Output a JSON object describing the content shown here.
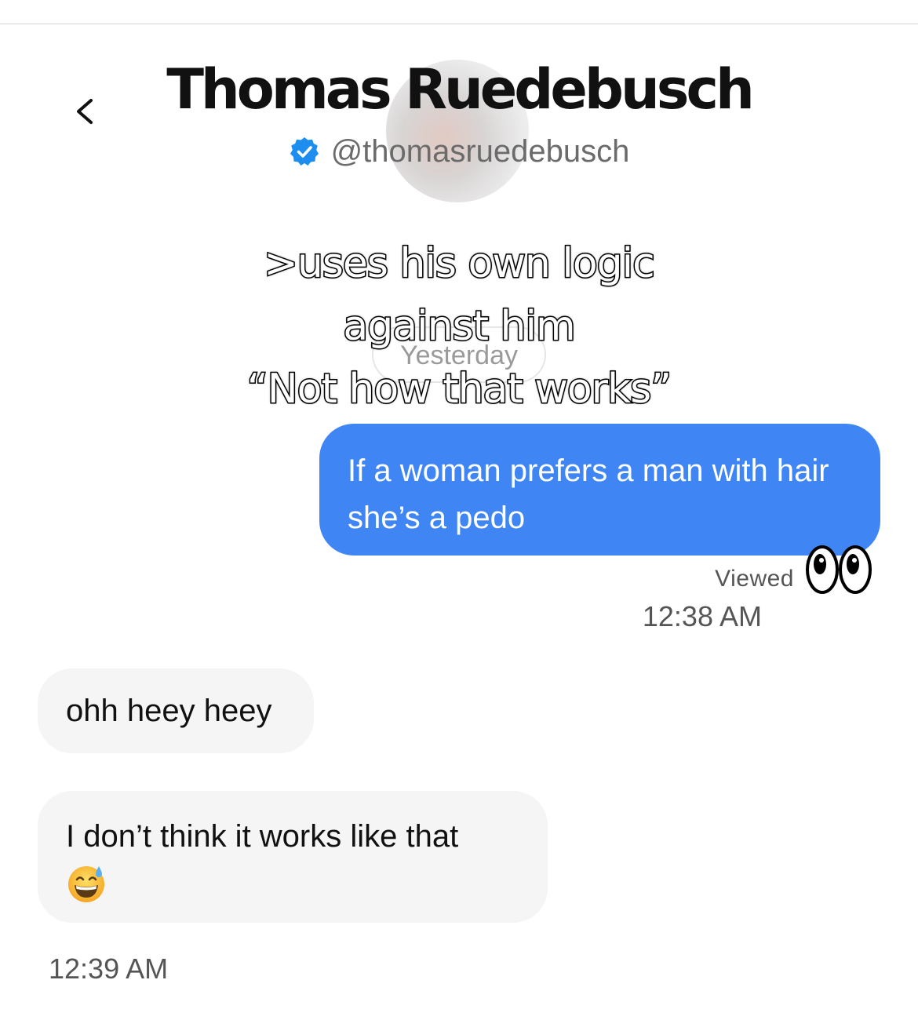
{
  "header": {
    "contact_name": "Thomas Ruedebusch",
    "handle": "@thomasruedebusch",
    "back_icon": "chevron-left-icon",
    "verified_icon": "verified-badge-icon",
    "verified_color": "#1d8df0"
  },
  "overlay": {
    "lines": [
      ">uses his own logic",
      "against him",
      "“Not how that works”"
    ]
  },
  "date_separator": "Yesterday",
  "messages": [
    {
      "direction": "outgoing",
      "text": "If a woman prefers a man with hair she’s a pedo",
      "status": "Viewed",
      "status_icon": "eyes-icon",
      "time": "12:38 AM"
    },
    {
      "direction": "incoming",
      "text": "ohh heey heey"
    },
    {
      "direction": "incoming",
      "text": "I don’t think it works like that",
      "emoji": "grinning-face-with-sweat-icon",
      "time": "12:39 AM"
    }
  ],
  "colors": {
    "outgoing_bubble": "#3f86f4",
    "incoming_bubble": "#f5f5f5",
    "meta_text": "#555555"
  }
}
